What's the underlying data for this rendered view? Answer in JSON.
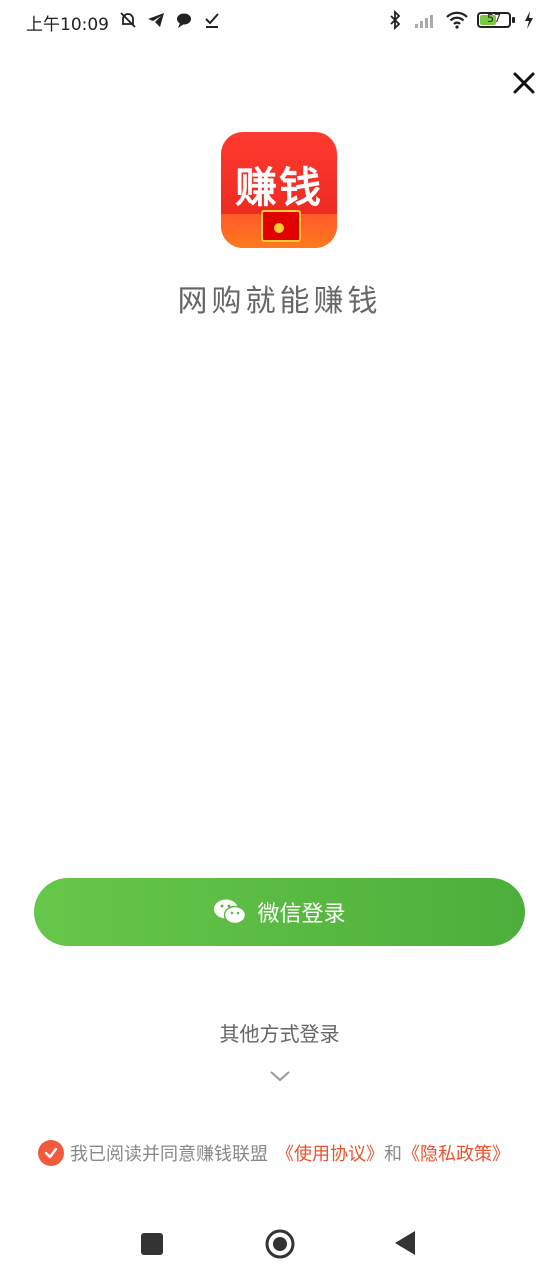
{
  "status_bar": {
    "time": "上午10:09",
    "battery_level": "57",
    "battery_fraction": 0.57
  },
  "app": {
    "logo_text": "赚钱",
    "slogan": "网购就能赚钱"
  },
  "login": {
    "wechat_button_label": "微信登录",
    "other_methods_label": "其他方式登录"
  },
  "agreement": {
    "prefix": "我已阅读并同意赚钱联盟",
    "terms_link": "《使用协议》",
    "conjunction": "和",
    "privacy_link": "《隐私政策》",
    "checked": true
  },
  "icons": {
    "close": "close-icon",
    "wechat": "wechat-icon",
    "chevron": "chevron-down-icon",
    "check": "checkmark-icon"
  },
  "colors": {
    "wechat_green": "#58b842",
    "link_orange": "#e9532f",
    "logo_red": "#e6231b"
  }
}
